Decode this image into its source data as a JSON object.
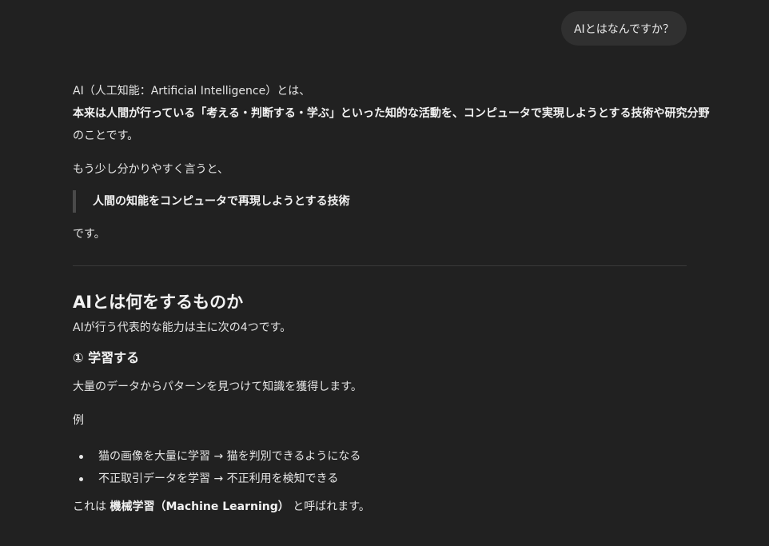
{
  "user_message": "AIとはなんですか？",
  "answer": {
    "intro_line1": "AI（人工知能：Artificial Intelligence）とは、",
    "intro_bold_line1": "本来は人間が行っている「考える・判断する・学ぶ」といった知的な活動を、コンピュータで実現しようとする技術や研究分野",
    "intro_line3": "のことです。",
    "simpler_lead": "もう少し分かりやすく言うと、",
    "quote": "人間の知能をコンピュータで再現しようとする技術",
    "quote_tail": "です。",
    "section_title": "AIとは何をするものか",
    "section_intro": "AIが行う代表的な能力は主に次の4つです。",
    "subsection1_title": "① 学習する",
    "subsection1_desc": "大量のデータからパターンを見つけて知識を獲得します。",
    "example_label": "例",
    "examples": [
      "猫の画像を大量に学習 → 猫を判別できるようになる",
      "不正取引データを学習 → 不正利用を検知できる"
    ],
    "ml_prefix": "これは ",
    "ml_bold": "機械学習（Machine Learning）",
    "ml_suffix": " と呼ばれます。"
  }
}
